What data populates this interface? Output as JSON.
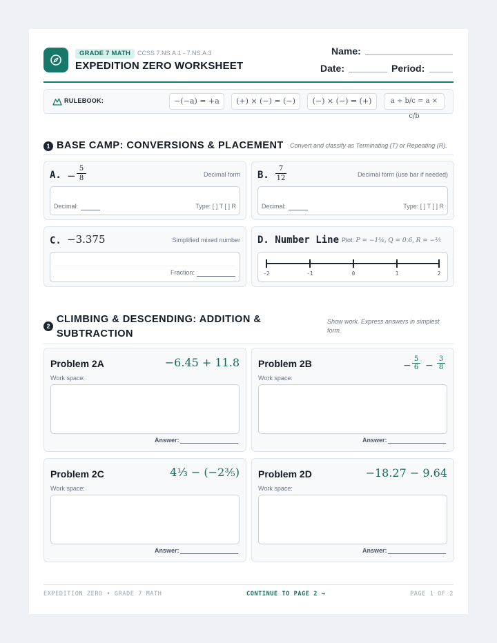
{
  "header": {
    "grade_badge": "GRADE 7 MATH",
    "standards": "CCSS 7.NS.A.1 - 7.NS.A.3",
    "title": "EXPEDITION ZERO WORKSHEET",
    "name_label": "Name:",
    "date_label": "Date:",
    "period_label": "Period:",
    "logo_icon": "compass-icon",
    "accent_color": "#17776a"
  },
  "rulebook": {
    "label": "RULEBOOK:",
    "icon": "mountain-icon",
    "rules": [
      "−(−a) = +a",
      "(+) × (−) = (−)",
      "(−) × (−) = (+)",
      "a ÷ b/c = a × c/b"
    ]
  },
  "section1": {
    "number": "1",
    "title": "BASE CAMP: CONVERSIONS & PLACEMENT",
    "note": "Convert and classify as Terminating (T) or Repeating (R).",
    "cardA": {
      "letter": "A.",
      "sign": "−",
      "num": "5",
      "den": "8",
      "tag": "Decimal form",
      "decimal_label": "Decimal:",
      "type_label": "Type: [  ] T  [  ] R"
    },
    "cardB": {
      "letter": "B.",
      "num": "7",
      "den": "12",
      "tag": "Decimal form (use bar if needed)",
      "decimal_label": "Decimal:",
      "type_label": "Type: [  ] T  [  ] R"
    },
    "cardC": {
      "letter": "C.",
      "expr": "−3.375",
      "tag": "Simplified mixed number",
      "fraction_label": "Fraction:"
    },
    "cardD": {
      "title": "D. Number Line",
      "plot_label": "Plot:",
      "plot_p": "P = −1¾,",
      "plot_q": "Q = 0.6,",
      "plot_r": "R = −⅖",
      "ticks": [
        "-2",
        "-1",
        "0",
        "1",
        "2"
      ]
    }
  },
  "section2": {
    "number": "2",
    "title_line1": "CLIMBING & DESCENDING: ADDITION &",
    "title_line2": "SUBTRACTION",
    "note_line1": "Show work. Express answers in simplest",
    "note_line2": "form.",
    "problems": [
      {
        "title": "Problem 2A",
        "expr": "−6.45 + 11.8",
        "work_label": "Work space:",
        "answer_label": "Answer:"
      },
      {
        "title": "Problem 2B",
        "expr": "−5/6 − 3/8",
        "work_label": "Work space:",
        "answer_label": "Answer:"
      },
      {
        "title": "Problem 2C",
        "expr": "4⅓ − (−2⅗)",
        "work_label": "Work space:",
        "answer_label": "Answer:"
      },
      {
        "title": "Problem 2D",
        "expr": "−18.27 − 9.64",
        "work_label": "Work space:",
        "answer_label": "Answer:"
      }
    ]
  },
  "footer": {
    "left": "EXPEDITION ZERO • GRADE 7 MATH",
    "center": "CONTINUE TO PAGE 2 →",
    "right": "PAGE 1 OF 2"
  }
}
